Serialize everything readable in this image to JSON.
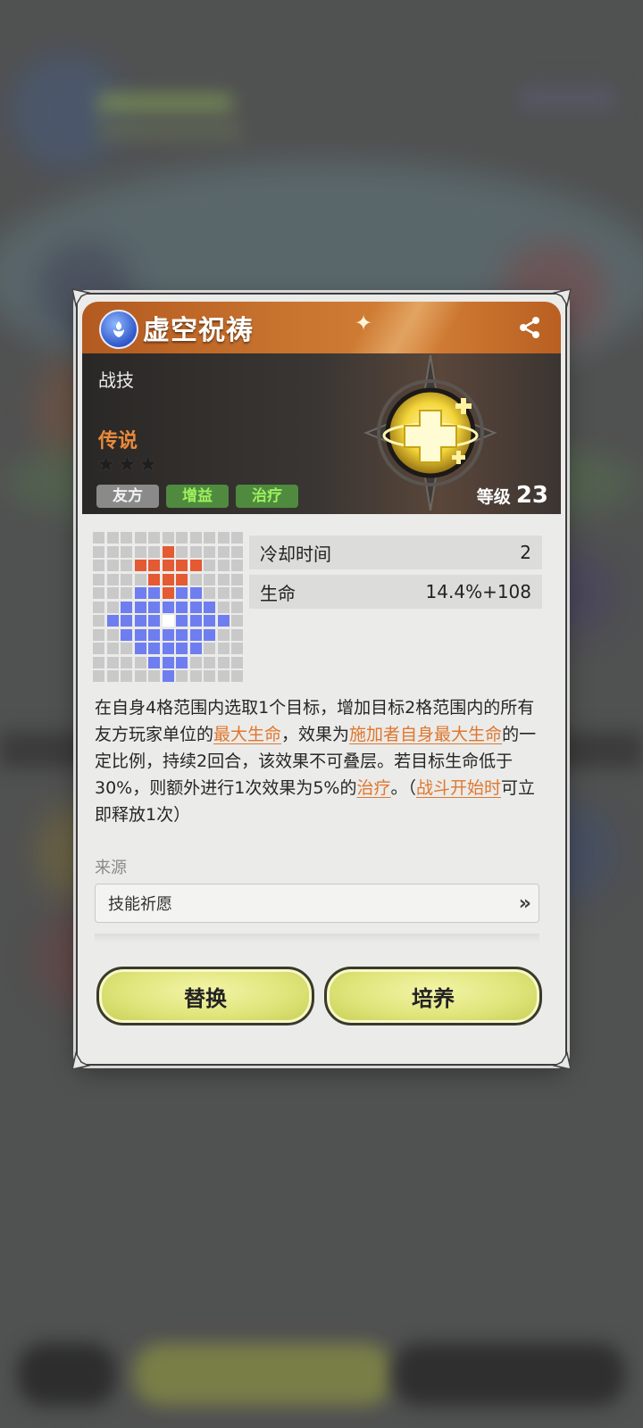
{
  "skill": {
    "name": "虚空祝祷",
    "type": "战技",
    "rarity": "传说",
    "stars": 3,
    "tags": [
      "友方",
      "增益",
      "治疗"
    ],
    "level_label": "等级",
    "level": "23"
  },
  "stats": [
    {
      "label": "冷却时间",
      "value": "2"
    },
    {
      "label": "生命",
      "value": "14.4%+108"
    }
  ],
  "range_grid": [
    "...........",
    ".....R.....",
    "...RRRRR...",
    "....RRR....",
    "...BBRBB...",
    "..BBBBBBB..",
    ".BBBBWBBBB.",
    "..BBBBBBB..",
    "...BBBBB...",
    "....BBB....",
    ".....B....."
  ],
  "description": {
    "p1": "在自身4格范围内选取1个目标，增加目标2格范围内的所有友方玩家单位的",
    "h1": "最大生命",
    "p2": "，效果为",
    "h2": "施加者自身最大生命",
    "p3": "的一定比例，持续2回合，该效果不可叠层。若目标生命低于30%，则额外进行1次效果为5%的",
    "h3": "治疗",
    "p4": "。（",
    "h4": "战斗开始时",
    "p5": "可立即释放1次）"
  },
  "source": {
    "label": "来源",
    "value": "技能祈愿"
  },
  "buttons": {
    "replace": "替换",
    "upgrade": "培养"
  },
  "colors": {
    "title_orange": "#c7722e",
    "highlight": "#e0772d",
    "tag_green_text": "#9df05f",
    "button_yellow": "#dfe57a",
    "range_red": "#e45a33",
    "range_blue": "#6e7ef0"
  }
}
